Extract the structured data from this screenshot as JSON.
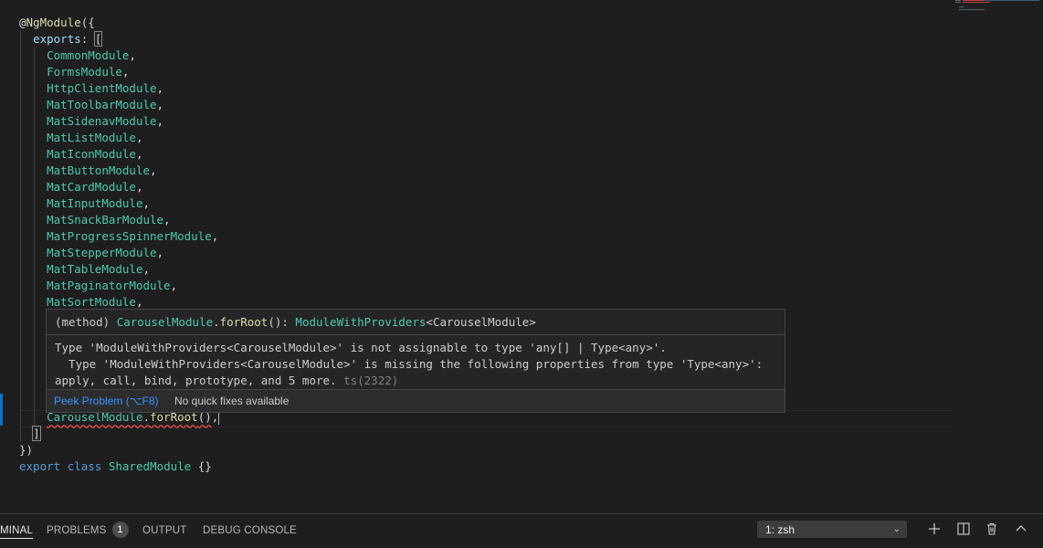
{
  "editor": {
    "lines": [
      {
        "parts": [
          {
            "t": "@",
            "c": "c-deco"
          },
          {
            "t": "NgModule",
            "c": "c-fn"
          },
          {
            "t": "({",
            "c": "c-punc"
          }
        ]
      },
      {
        "parts": [
          {
            "t": "  ",
            "c": "c-punc"
          },
          {
            "t": "exports",
            "c": "c-prop"
          },
          {
            "t": ": ",
            "c": "c-punc"
          },
          {
            "t": "[",
            "c": "c-punc bracket-hl"
          }
        ]
      },
      {
        "parts": [
          {
            "t": "    ",
            "c": "c-punc"
          },
          {
            "t": "CommonModule",
            "c": "c-ident"
          },
          {
            "t": ",",
            "c": "c-punc"
          }
        ]
      },
      {
        "parts": [
          {
            "t": "    ",
            "c": "c-punc"
          },
          {
            "t": "FormsModule",
            "c": "c-ident"
          },
          {
            "t": ",",
            "c": "c-punc"
          }
        ]
      },
      {
        "parts": [
          {
            "t": "    ",
            "c": "c-punc"
          },
          {
            "t": "HttpClientModule",
            "c": "c-ident"
          },
          {
            "t": ",",
            "c": "c-punc"
          }
        ]
      },
      {
        "parts": [
          {
            "t": "    ",
            "c": "c-punc"
          },
          {
            "t": "MatToolbarModule",
            "c": "c-ident"
          },
          {
            "t": ",",
            "c": "c-punc"
          }
        ]
      },
      {
        "parts": [
          {
            "t": "    ",
            "c": "c-punc"
          },
          {
            "t": "MatSidenavModule",
            "c": "c-ident"
          },
          {
            "t": ",",
            "c": "c-punc"
          }
        ]
      },
      {
        "parts": [
          {
            "t": "    ",
            "c": "c-punc"
          },
          {
            "t": "MatListModule",
            "c": "c-ident"
          },
          {
            "t": ",",
            "c": "c-punc"
          }
        ]
      },
      {
        "parts": [
          {
            "t": "    ",
            "c": "c-punc"
          },
          {
            "t": "MatIconModule",
            "c": "c-ident"
          },
          {
            "t": ",",
            "c": "c-punc"
          }
        ]
      },
      {
        "parts": [
          {
            "t": "    ",
            "c": "c-punc"
          },
          {
            "t": "MatButtonModule",
            "c": "c-ident"
          },
          {
            "t": ",",
            "c": "c-punc"
          }
        ]
      },
      {
        "parts": [
          {
            "t": "    ",
            "c": "c-punc"
          },
          {
            "t": "MatCardModule",
            "c": "c-ident"
          },
          {
            "t": ",",
            "c": "c-punc"
          }
        ]
      },
      {
        "parts": [
          {
            "t": "    ",
            "c": "c-punc"
          },
          {
            "t": "MatInputModule",
            "c": "c-ident"
          },
          {
            "t": ",",
            "c": "c-punc"
          }
        ]
      },
      {
        "parts": [
          {
            "t": "    ",
            "c": "c-punc"
          },
          {
            "t": "MatSnackBarModule",
            "c": "c-ident"
          },
          {
            "t": ",",
            "c": "c-punc"
          }
        ]
      },
      {
        "parts": [
          {
            "t": "    ",
            "c": "c-punc"
          },
          {
            "t": "MatProgressSpinnerModule",
            "c": "c-ident"
          },
          {
            "t": ",",
            "c": "c-punc"
          }
        ]
      },
      {
        "parts": [
          {
            "t": "    ",
            "c": "c-punc"
          },
          {
            "t": "MatStepperModule",
            "c": "c-ident"
          },
          {
            "t": ",",
            "c": "c-punc"
          }
        ]
      },
      {
        "parts": [
          {
            "t": "    ",
            "c": "c-punc"
          },
          {
            "t": "MatTableModule",
            "c": "c-ident"
          },
          {
            "t": ",",
            "c": "c-punc"
          }
        ]
      },
      {
        "parts": [
          {
            "t": "    ",
            "c": "c-punc"
          },
          {
            "t": "MatPaginatorModule",
            "c": "c-ident"
          },
          {
            "t": ",",
            "c": "c-punc"
          }
        ]
      },
      {
        "parts": [
          {
            "t": "    ",
            "c": "c-punc"
          },
          {
            "t": "MatSortModule",
            "c": "c-ident"
          },
          {
            "t": ",",
            "c": "c-punc"
          }
        ]
      },
      {
        "parts": []
      },
      {
        "parts": []
      },
      {
        "parts": []
      },
      {
        "parts": []
      },
      {
        "parts": []
      },
      {
        "parts": []
      },
      {
        "parts": [
          {
            "t": "    ",
            "c": "c-punc"
          },
          {
            "t": "CarouselModule",
            "c": "c-ident err"
          },
          {
            "t": ".",
            "c": "c-punc err"
          },
          {
            "t": "forRoot",
            "c": "c-fn err"
          },
          {
            "t": "()",
            "c": "c-punc err"
          },
          {
            "t": ",",
            "c": "c-punc"
          },
          {
            "t": "|cursor|",
            "c": "cursor"
          }
        ]
      },
      {
        "parts": [
          {
            "t": "  ",
            "c": "c-punc"
          },
          {
            "t": "]",
            "c": "c-punc bracket-hl"
          }
        ]
      },
      {
        "parts": [
          {
            "t": "})",
            "c": "c-punc"
          }
        ]
      },
      {
        "parts": [
          {
            "t": "export",
            "c": "c-kw"
          },
          {
            "t": " ",
            "c": "c-punc"
          },
          {
            "t": "class",
            "c": "c-kw"
          },
          {
            "t": " ",
            "c": "c-punc"
          },
          {
            "t": "SharedModule",
            "c": "c-type"
          },
          {
            "t": " {}",
            "c": "c-punc"
          }
        ]
      }
    ]
  },
  "hover": {
    "signature_prefix": "(method) ",
    "signature_class": "CarouselModule",
    "signature_dot": ".",
    "signature_method": "forRoot",
    "signature_rest": "(): ",
    "signature_return": "ModuleWithProviders",
    "signature_generic": "<CarouselModule>",
    "message_line1": "Type 'ModuleWithProviders<CarouselModule>' is not assignable to type 'any[] | Type<any>'.",
    "message_line2": "  Type 'ModuleWithProviders<CarouselModule>' is missing the following properties from type 'Type<any>':",
    "message_line3": "apply, call, bind, prototype, and 5 more. ",
    "error_code": "ts(2322)",
    "peek_label": "Peek Problem (⌥F8)",
    "no_fix_label": "No quick fixes available"
  },
  "panel": {
    "tabs": [
      {
        "label": "MINAL",
        "active": true
      },
      {
        "label": "PROBLEMS",
        "active": false,
        "badge": "1"
      },
      {
        "label": "OUTPUT",
        "active": false
      },
      {
        "label": "DEBUG CONSOLE",
        "active": false
      }
    ],
    "terminal_select": "1: zsh",
    "icons": [
      "plus-icon",
      "split-icon",
      "trash-icon",
      "chevron-up-icon"
    ]
  },
  "colors": {
    "background": "#1e1e1e",
    "accent": "#007acc",
    "error": "#f14c4c",
    "link": "#3794ff"
  }
}
